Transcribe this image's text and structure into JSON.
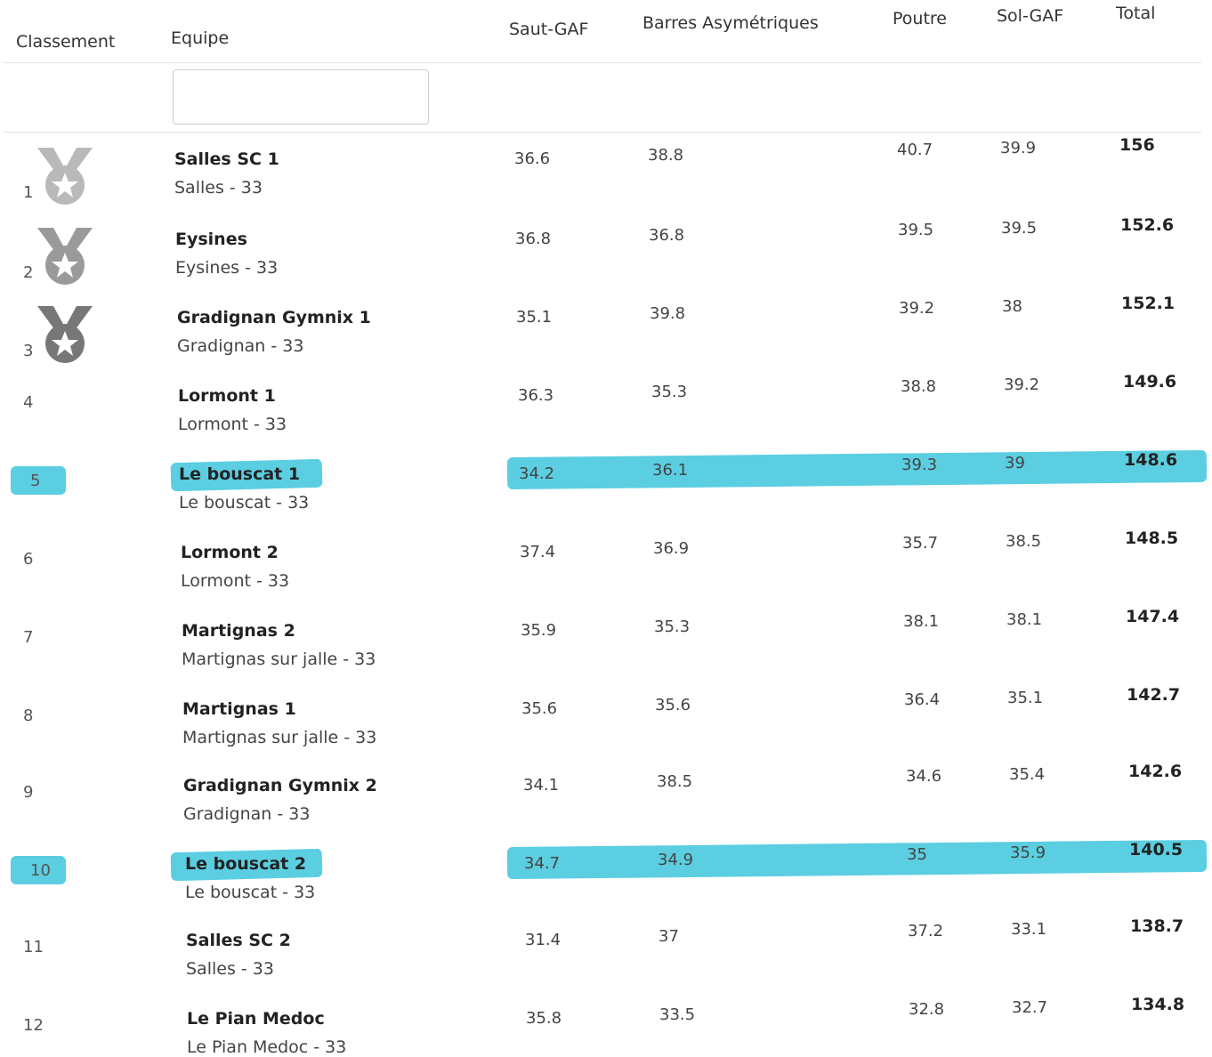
{
  "columns": {
    "rank": "Classement",
    "team": "Equipe",
    "vault": "Saut-GAF",
    "bars": "Barres Asymétriques",
    "beam": "Poutre",
    "floor": "Sol-GAF",
    "total": "Total"
  },
  "filter": {
    "placeholder": "",
    "value": ""
  },
  "highlight_color": "#3ec6dc",
  "medal_colors": [
    "#b9b9b9",
    "#9a9a9a",
    "#777777"
  ],
  "rows": [
    {
      "rank": "1",
      "medal": "medal-1-icon",
      "name": "Salles SC 1",
      "club": "Salles - 33",
      "vault": "36.6",
      "bars": "38.8",
      "beam": "40.7",
      "floor": "39.9",
      "total": "156",
      "highlighted": false
    },
    {
      "rank": "2",
      "medal": "medal-2-icon",
      "name": "Eysines",
      "club": "Eysines - 33",
      "vault": "36.8",
      "bars": "36.8",
      "beam": "39.5",
      "floor": "39.5",
      "total": "152.6",
      "highlighted": false
    },
    {
      "rank": "3",
      "medal": "medal-3-icon",
      "name": "Gradignan Gymnix 1",
      "club": "Gradignan - 33",
      "vault": "35.1",
      "bars": "39.8",
      "beam": "39.2",
      "floor": "38",
      "total": "152.1",
      "highlighted": false
    },
    {
      "rank": "4",
      "medal": "",
      "name": "Lormont 1",
      "club": "Lormont - 33",
      "vault": "36.3",
      "bars": "35.3",
      "beam": "38.8",
      "floor": "39.2",
      "total": "149.6",
      "highlighted": false
    },
    {
      "rank": "5",
      "medal": "",
      "name": "Le bouscat 1",
      "club": "Le bouscat - 33",
      "vault": "34.2",
      "bars": "36.1",
      "beam": "39.3",
      "floor": "39",
      "total": "148.6",
      "highlighted": true
    },
    {
      "rank": "6",
      "medal": "",
      "name": "Lormont 2",
      "club": "Lormont - 33",
      "vault": "37.4",
      "bars": "36.9",
      "beam": "35.7",
      "floor": "38.5",
      "total": "148.5",
      "highlighted": false
    },
    {
      "rank": "7",
      "medal": "",
      "name": "Martignas 2",
      "club": "Martignas sur jalle - 33",
      "vault": "35.9",
      "bars": "35.3",
      "beam": "38.1",
      "floor": "38.1",
      "total": "147.4",
      "highlighted": false
    },
    {
      "rank": "8",
      "medal": "",
      "name": "Martignas 1",
      "club": "Martignas sur jalle - 33",
      "vault": "35.6",
      "bars": "35.6",
      "beam": "36.4",
      "floor": "35.1",
      "total": "142.7",
      "highlighted": false
    },
    {
      "rank": "9",
      "medal": "",
      "name": "Gradignan Gymnix 2",
      "club": "Gradignan - 33",
      "vault": "34.1",
      "bars": "38.5",
      "beam": "34.6",
      "floor": "35.4",
      "total": "142.6",
      "highlighted": false
    },
    {
      "rank": "10",
      "medal": "",
      "name": "Le bouscat 2",
      "club": "Le bouscat - 33",
      "vault": "34.7",
      "bars": "34.9",
      "beam": "35",
      "floor": "35.9",
      "total": "140.5",
      "highlighted": true
    },
    {
      "rank": "11",
      "medal": "",
      "name": "Salles SC 2",
      "club": "Salles - 33",
      "vault": "31.4",
      "bars": "37",
      "beam": "37.2",
      "floor": "33.1",
      "total": "138.7",
      "highlighted": false
    },
    {
      "rank": "12",
      "medal": "",
      "name": "Le Pian Medoc",
      "club": "Le Pian Medoc - 33",
      "vault": "35.8",
      "bars": "33.5",
      "beam": "32.8",
      "floor": "32.7",
      "total": "134.8",
      "highlighted": false
    }
  ]
}
